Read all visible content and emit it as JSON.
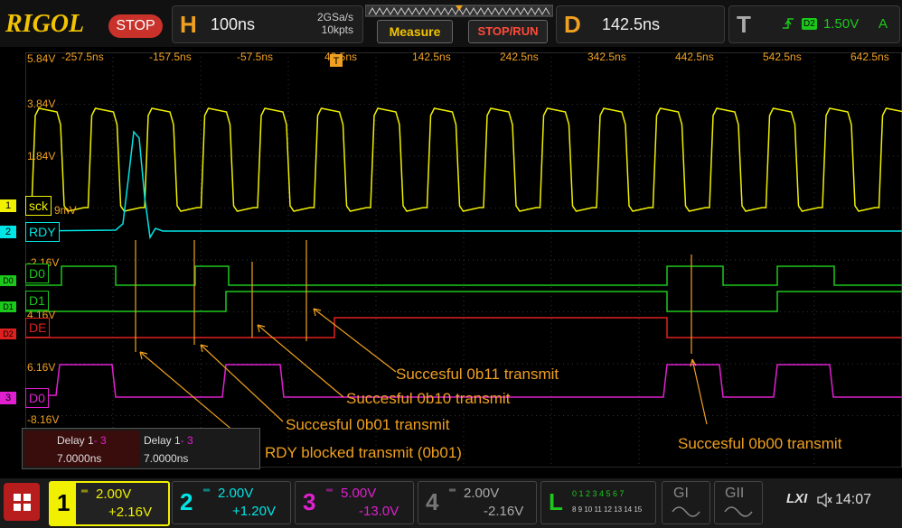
{
  "brand": "RIGOL",
  "run_state": "STOP",
  "horizontal": {
    "letter": "H",
    "timebase": "100ns",
    "sample_rate": "2GSa/s",
    "memory_depth": "10kpts"
  },
  "menu": {
    "measure": "Measure",
    "stop_run": "STOP/RUN"
  },
  "delay": {
    "letter": "D",
    "value": "142.5ns"
  },
  "trigger": {
    "letter": "T",
    "source": "D2",
    "level": "1.50V",
    "mode": "A"
  },
  "time_axis": [
    "-257.5ns",
    "-157.5ns",
    "-57.5ns",
    "42.5ns",
    "142.5ns",
    "242.5ns",
    "342.5ns",
    "442.5ns",
    "542.5ns",
    "642.5ns"
  ],
  "volt_scale": {
    "top": "5.84V",
    "v1": "3.84V",
    "v2": "1.84V",
    "v3": "-2.16V",
    "v4": "6.16V",
    "v5": "-8.16V",
    "sck_partial": "9mV",
    "d1_partial": "4.16V"
  },
  "channels": {
    "sck": {
      "num": "1",
      "label": "sck",
      "color": "#f0f000"
    },
    "rdy": {
      "num": "2",
      "label": "RDY",
      "color": "#00e5e5"
    },
    "d0": {
      "num": "D0",
      "label": "D0",
      "color": "#1cc81c"
    },
    "d1": {
      "num": "D1",
      "label": "D1",
      "color": "#1cc81c"
    },
    "de": {
      "num": "D2",
      "label": "DE",
      "color": "#e02020"
    },
    "d0a": {
      "num": "3",
      "label": "D0",
      "color": "#e020d0"
    }
  },
  "annotations": {
    "a1": "Succesful 0b11 transmit",
    "a2": "Succesful 0b10 transmit",
    "a3": "Succesful 0b01 transmit",
    "a4": "RDY blocked transmit (0b01)",
    "a5": "Succesful 0b00 transmit"
  },
  "measure_table": {
    "h1": "Delay 1",
    "h1b": "- 3",
    "h2": "Delay 1",
    "h2b": "- 3",
    "v1": "7.0000ns",
    "v2": "7.0000ns"
  },
  "bottom": {
    "ch1": {
      "num": "1",
      "scale": "2.00V",
      "offset": "+2.16V"
    },
    "ch2": {
      "num": "2",
      "scale": "2.00V",
      "offset": "+1.20V"
    },
    "ch3": {
      "num": "3",
      "scale": "5.00V",
      "offset": "-13.0V"
    },
    "ch4": {
      "num": "4",
      "scale": "2.00V",
      "offset": "-2.16V"
    },
    "la": {
      "letter": "L",
      "row1": "0 1 2 3  4 5 6 7",
      "row2": "8 9 10 11 12 13 14 15"
    },
    "g1": "GI",
    "g2": "GII",
    "lxi": "LXI",
    "time": "14:07"
  },
  "colors": {
    "accent": "#f0a020",
    "sck": "#f0f000",
    "rdy": "#00e5e5",
    "logic": "#1cc81c",
    "de": "#e02020",
    "ch3": "#e020d0"
  }
}
